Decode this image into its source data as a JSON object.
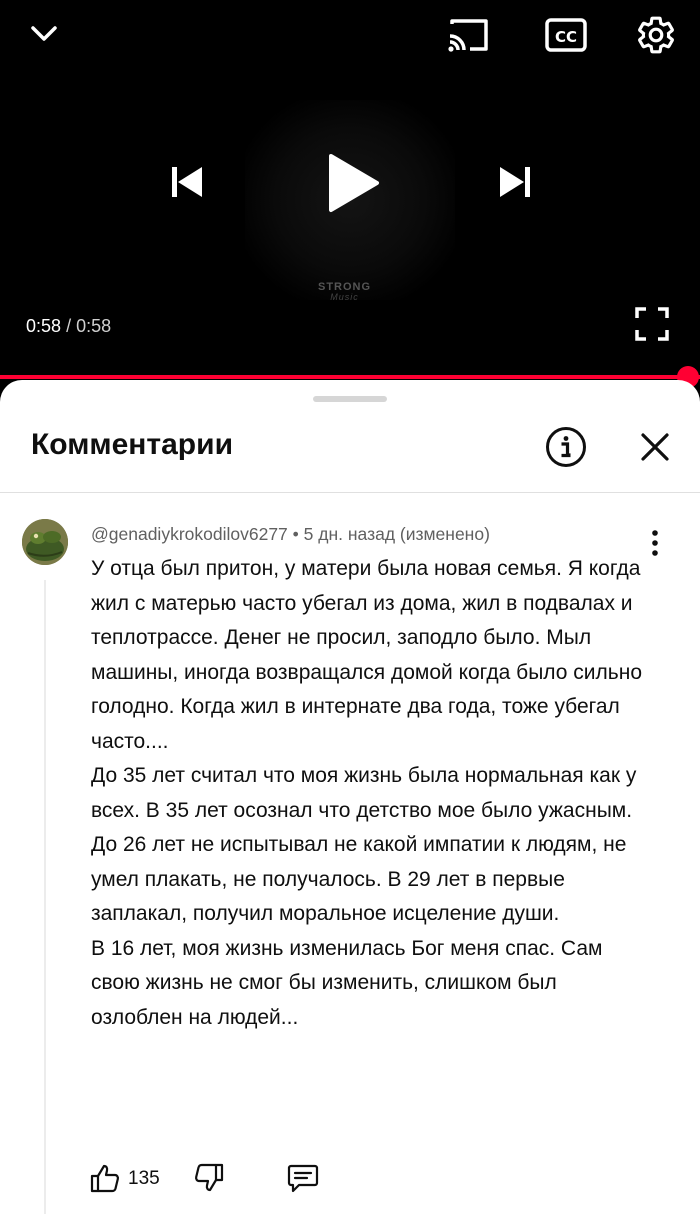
{
  "player": {
    "current_time": "0:58",
    "separator": "/",
    "duration": "0:58",
    "progress": 1.0,
    "watermark_line1": "STRONG",
    "watermark_line2": "Music",
    "accent_color": "#ff0033",
    "icons": [
      "chevron-down-icon",
      "cast-icon",
      "closed-captions-icon",
      "gear-icon",
      "skip-previous-icon",
      "play-icon",
      "skip-next-icon",
      "fullscreen-icon"
    ]
  },
  "comments_panel": {
    "title": "Комментарии",
    "icons": [
      "info-icon",
      "close-icon"
    ]
  },
  "comment": {
    "author": "@genadiykrokodilov6277",
    "meta_separator": "•",
    "time": "5 дн. назад (изменено)",
    "paragraphs": [
      "У отца был притон, у матери была новая семья. Я когда жил с матерью часто убегал из дома, жил в подвалах и теплотрассе. Денег не просил, заподло было. Мыл машины, иногда возвращался домой когда было сильно голодно. Когда жил в интернате два года, тоже убегал часто....",
      "До 35 лет считал что моя жизнь была нормальная как у всех. В 35 лет осознал что детство мое было ужасным.",
      "До 26 лет не испытывал не какой импатии к людям, не умел плакать, не получалось. В 29 лет в первые заплакал, получил моральное исцеление души.",
      "В 16 лет, моя жизнь изменилась Бог меня спас. Сам свою жизнь не смог бы изменить, слишком был озлоблен на людей..."
    ],
    "likes": "135",
    "icons": [
      "avatar",
      "more-vert-icon",
      "thumb-up-icon",
      "thumb-down-icon",
      "reply-icon"
    ]
  }
}
